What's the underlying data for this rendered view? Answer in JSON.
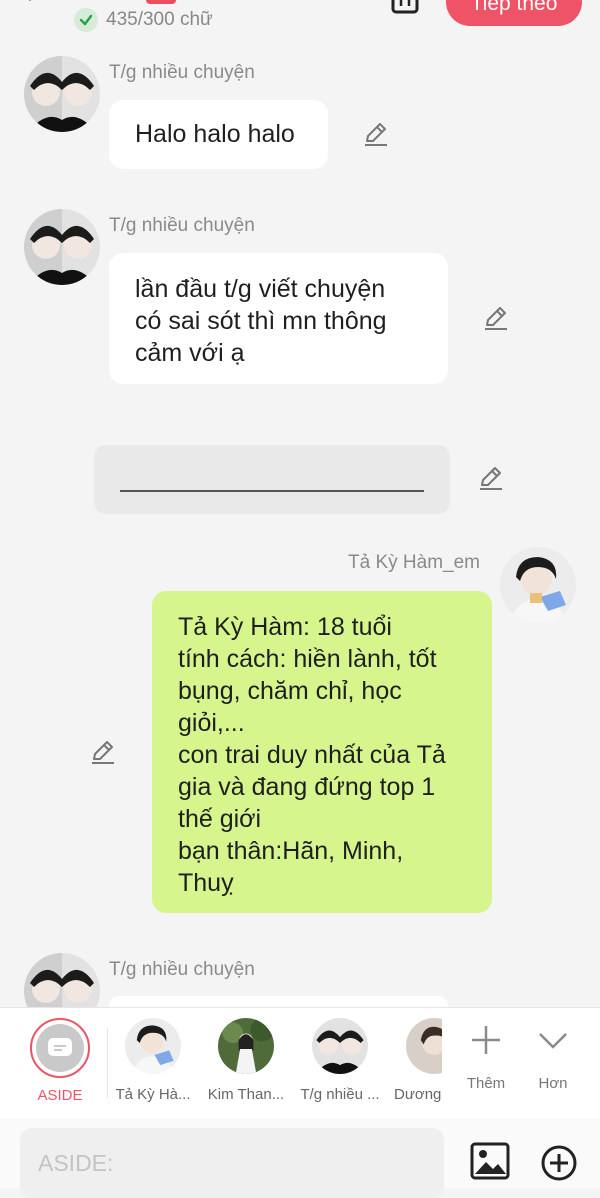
{
  "header": {
    "word_count": "435/300 chữ",
    "next_label": "Tiếp theo"
  },
  "messages": [
    {
      "sender": "T/g nhiều chuyện",
      "lines": [
        "Halo halo halo"
      ]
    },
    {
      "sender": "T/g nhiều chuyện",
      "lines": [
        "lần đầu t/g viết chuyện",
        "có sai sót thì mn thông",
        "cảm với ạ"
      ]
    },
    {
      "sender": "Tả Kỳ Hàm_em",
      "lines": [
        "Tả Kỳ Hàm: 18 tuổi",
        "tính cách: hiền lành, tốt",
        "bụng, chăm chỉ, học",
        "giỏi,...",
        "con trai duy nhất của Tả",
        "gia và đang đứng top 1",
        "thế giới",
        "bạn thân:Hãn, Minh,",
        "Thuỵ"
      ]
    },
    {
      "sender": "T/g nhiều chuyện"
    }
  ],
  "character_bar": {
    "aside_label": "ASIDE",
    "characters": [
      "Tả Kỳ Hà...",
      "Kim Than...",
      "T/g nhiều ...",
      "Dương"
    ],
    "add_label": "Thêm",
    "more_label": "Hơn"
  },
  "input": {
    "placeholder": "ASIDE:"
  },
  "colors": {
    "accent": "#ef5367",
    "green_bubble": "#d6f58c",
    "check_green": "#2e9e48"
  }
}
